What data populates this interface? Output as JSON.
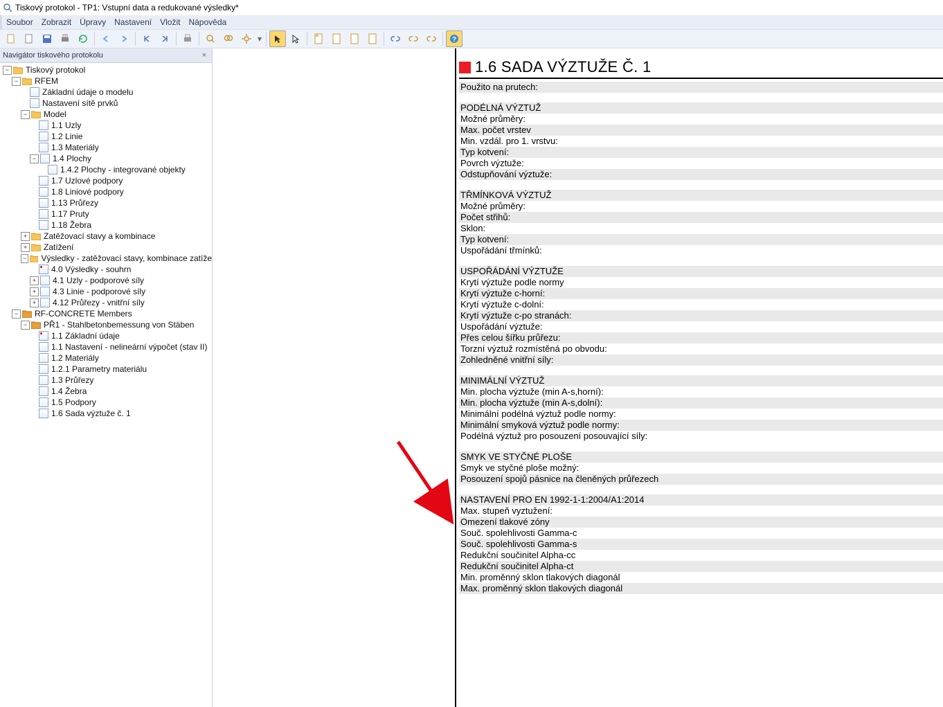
{
  "window": {
    "title": "Tiskový protokol - TP1: Vstupní data a redukované výsledky*"
  },
  "menu": {
    "soubor": "Soubor",
    "zobrazit": "Zobrazit",
    "upravy": "Úpravy",
    "nastaveni": "Nastavení",
    "vlozit": "Vložit",
    "napoveda": "Nápověda"
  },
  "nav": {
    "title": "Navigátor tiskového protokolu",
    "root": "Tiskový protokol",
    "rfem": "RFEM",
    "model_basic": "Základní údaje o modelu",
    "mesh": "Nastavení sítě prvků",
    "model": "Model",
    "n11": "1.1 Uzly",
    "n12": "1.2 Linie",
    "n13": "1.3 Materiály",
    "n14": "1.4 Plochy",
    "n142": "1.4.2 Plochy - integrované objekty",
    "n17": "1.7 Uzlové podpory",
    "n18": "1.8 Liniové podpory",
    "n113": "1.13 Průřezy",
    "n117": "1.17 Pruty",
    "n118": "1.18 Žebra",
    "lc": "Zatěžovací stavy a kombinace",
    "loads": "Zatížení",
    "results": "Výsledky - zatěžovací stavy, kombinace zatíže",
    "r40": "4.0 Výsledky - souhrn",
    "r41": "4.1 Uzly - podporové síly",
    "r43": "4.3 Linie - podporové síly",
    "r412": "4.12 Průřezy - vnitřní síly",
    "rfc": "RF-CONCRETE Members",
    "pr1": "PŘ1 - Stahlbetonbemessung von Stäben",
    "p11": "1.1 Základní údaje",
    "p11n": "1.1 Nastavení - nelineární výpočet (stav II)",
    "p12": "1.2 Materiály",
    "p121": "1.2.1 Parametry materiálu",
    "p13": "1.3 Průřezy",
    "p14": "1.4 Žebra",
    "p15": "1.5 Podpory",
    "p16": "1.6 Sada výztuže č. 1"
  },
  "doc": {
    "h1": "1.6 SADA VÝZTUŽE Č. 1",
    "used_on": "Použito na prutech:",
    "s1": "PODÉLNÁ VÝZTUŽ",
    "s1_1": "Možné průměry:",
    "s1_2": "Max. počet vrstev",
    "s1_3": "Min. vzdál. pro 1. vrstvu:",
    "s1_4": "Typ kotvení:",
    "s1_5": "Povrch výztuže:",
    "s1_6": "Odstupňování výztuže:",
    "s2": "TŘMÍNKOVÁ VÝZTUŽ",
    "s2_1": "Možné průměry:",
    "s2_2": "Počet střihů:",
    "s2_3": "Sklon:",
    "s2_4": "Typ kotvení:",
    "s2_5": "Uspořádání třmínků:",
    "s3": "USPOŘÁDÁNÍ VÝZTUŽE",
    "s3_1": "Krytí výztuže podle normy",
    "s3_2": "Krytí výztuže c-horní:",
    "s3_3": "Krytí výztuže c-dolní:",
    "s3_4": "Krytí výztuže c-po stranách:",
    "s3_5": "Uspořádání výztuže:",
    "s3_6": "Přes celou šířku průřezu:",
    "s3_7": "Torzní výztuž rozmístěná po obvodu:",
    "s3_8": "Zohledněné vnitřní síly:",
    "s4": "MINIMÁLNÍ VÝZTUŽ",
    "s4_1": "Min. plocha výztuže (min A-s,horní):",
    "s4_2": "Min. plocha výztuže (min A-s,dolní):",
    "s4_3": "Minimální podélná výztuž podle normy:",
    "s4_4": "Minimální smyková výztuž podle normy:",
    "s4_5": "Podélná výztuž pro posouzení posouvající síly:",
    "s5": "SMYK VE STYČNÉ PLOŠE",
    "s5_1": "Smyk ve styčné ploše možný:",
    "s5_2": "Posouzení spojů pásnice na členěných průřezech",
    "s6": "NASTAVENÍ PRO EN 1992-1-1:2004/A1:2014",
    "s6_1": "Max. stupeň vyztužení:",
    "s6_2": "Omezení tlakové zóny",
    "s6_3": "Souč. spolehlivosti Gamma-c",
    "s6_4": "Souč. spolehlivosti Gamma-s",
    "s6_5": "Redukční součinitel Alpha-cc",
    "s6_6": "Redukční součinitel Alpha-ct",
    "s6_7": "Min. proměnný sklon tlakových diagonál",
    "s6_8": "Max. proměnný sklon tlakových diagonál"
  }
}
